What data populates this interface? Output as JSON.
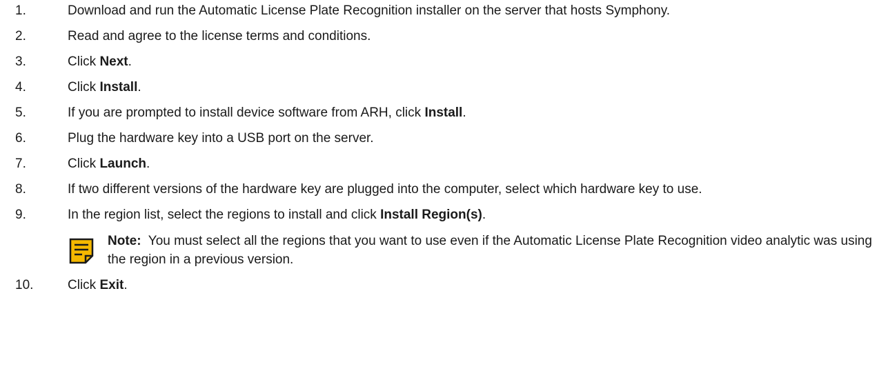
{
  "steps": [
    {
      "num": "1.",
      "text": "Download and run the Automatic License Plate Recognition installer on the server that hosts Symphony."
    },
    {
      "num": "2.",
      "text": "Read and agree to the license terms and conditions."
    },
    {
      "num": "3.",
      "pre": "Click ",
      "bold": "Next",
      "post": "."
    },
    {
      "num": "4.",
      "pre": "Click ",
      "bold": "Install",
      "post": "."
    },
    {
      "num": "5.",
      "pre": "If you are prompted to install device software from ARH, click ",
      "bold": "Install",
      "post": "."
    },
    {
      "num": "6.",
      "text": "Plug the hardware key into a USB port on the server."
    },
    {
      "num": "7.",
      "pre": "Click ",
      "bold": "Launch",
      "post": "."
    },
    {
      "num": "8.",
      "text": "If two different versions of the hardware key are plugged into the computer, select which hardware key to use."
    },
    {
      "num": "9.",
      "pre": "In the region list, select the regions to install and click ",
      "bold": "Install Region(s)",
      "post": "."
    },
    {
      "num": "10.",
      "pre": "Click ",
      "bold": "Exit",
      "post": "."
    }
  ],
  "note": {
    "label": "Note:",
    "text": "You must select all the regions that you want to use even if the Automatic License Plate Recognition video analytic was using the region in a previous version.",
    "icon": "note-icon",
    "icon_color": "#f5b800"
  }
}
